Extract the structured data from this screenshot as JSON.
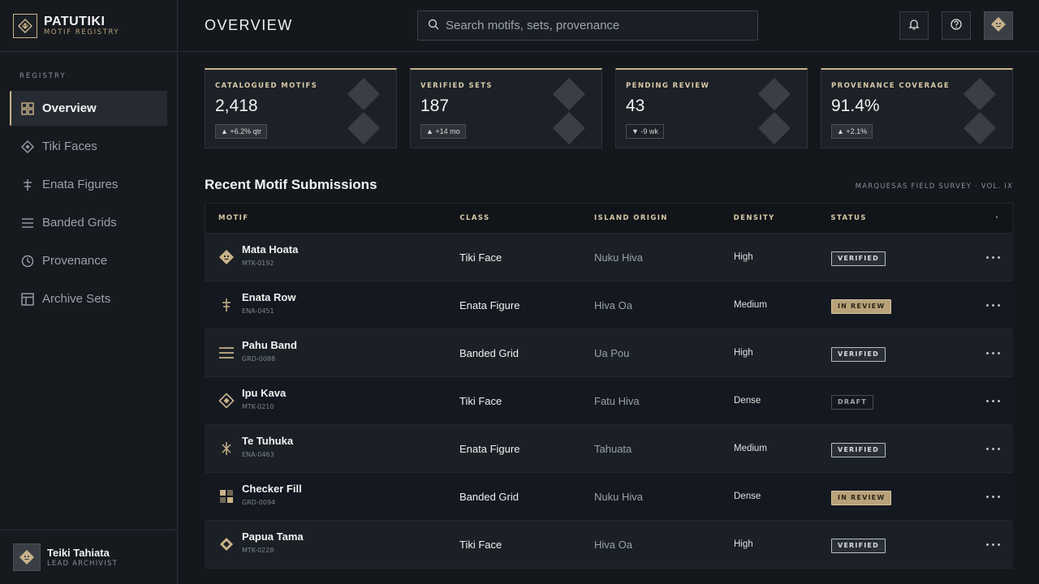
{
  "brand": {
    "name": "PATUTIKI",
    "subtitle": "MOTIF REGISTRY"
  },
  "sidebar": {
    "section_label": "REGISTRY",
    "items": [
      {
        "label": "Overview",
        "icon": "grid-icon",
        "active": true
      },
      {
        "label": "Tiki Faces",
        "icon": "diamond-icon",
        "active": false
      },
      {
        "label": "Enata Figures",
        "icon": "figure-icon",
        "active": false
      },
      {
        "label": "Banded Grids",
        "icon": "bands-icon",
        "active": false
      },
      {
        "label": "Provenance",
        "icon": "clock-icon",
        "active": false
      },
      {
        "label": "Archive Sets",
        "icon": "archive-icon",
        "active": false
      }
    ]
  },
  "user": {
    "name": "Teiki Tahiata",
    "role": "LEAD ARCHIVIST"
  },
  "header": {
    "title": "OVERVIEW",
    "search_placeholder": "Search motifs, sets, provenance"
  },
  "stats": [
    {
      "label": "CATALOGUED MOTIFS",
      "value": "2,418",
      "delta": "▲ +6.2% qtr"
    },
    {
      "label": "VERIFIED SETS",
      "value": "187",
      "delta": "▲ +14 mo"
    },
    {
      "label": "PENDING REVIEW",
      "value": "43",
      "delta": "▼ -9 wk"
    },
    {
      "label": "PROVENANCE COVERAGE",
      "value": "91.4%",
      "delta": "▲ +2.1%"
    }
  ],
  "table": {
    "title": "Recent Motif Submissions",
    "meta": "MARQUESAS FIELD SURVEY · VOL. IX",
    "columns": {
      "motif": "MOTIF",
      "class": "CLASS",
      "origin": "ISLAND ORIGIN",
      "density": "DENSITY",
      "status": "STATUS",
      "more": "·"
    },
    "rows": [
      {
        "name": "Mata Hoata",
        "code": "MTK-0192",
        "class": "Tiki Face",
        "origin": "Nuku Hiva",
        "density": "High",
        "status": "VERIFIED",
        "icon": "face-diamond-icon"
      },
      {
        "name": "Enata Row",
        "code": "ENA-0451",
        "class": "Enata Figure",
        "origin": "Hiva Oa",
        "density": "Medium",
        "status": "IN REVIEW",
        "icon": "figure-icon"
      },
      {
        "name": "Pahu Band",
        "code": "GRD-0088",
        "class": "Banded Grid",
        "origin": "Ua Pou",
        "density": "High",
        "status": "VERIFIED",
        "icon": "bands-icon"
      },
      {
        "name": "Ipu Kava",
        "code": "MTK-0210",
        "class": "Tiki Face",
        "origin": "Fatu Hiva",
        "density": "Dense",
        "status": "DRAFT",
        "icon": "diamond-outline-icon"
      },
      {
        "name": "Te Tuhuka",
        "code": "ENA-0463",
        "class": "Enata Figure",
        "origin": "Tahuata",
        "density": "Medium",
        "status": "VERIFIED",
        "icon": "star-figure-icon"
      },
      {
        "name": "Checker Fill",
        "code": "GRD-0094",
        "class": "Banded Grid",
        "origin": "Nuku Hiva",
        "density": "Dense",
        "status": "IN REVIEW",
        "icon": "checker-icon"
      },
      {
        "name": "Papua Tama",
        "code": "MTK-0228",
        "class": "Tiki Face",
        "origin": "Hiva Oa",
        "density": "High",
        "status": "VERIFIED",
        "icon": "diamond-nested-icon"
      }
    ]
  },
  "colors": {
    "accent": "#c9b38a",
    "background": "#14181d",
    "panel": "#1c2127"
  }
}
